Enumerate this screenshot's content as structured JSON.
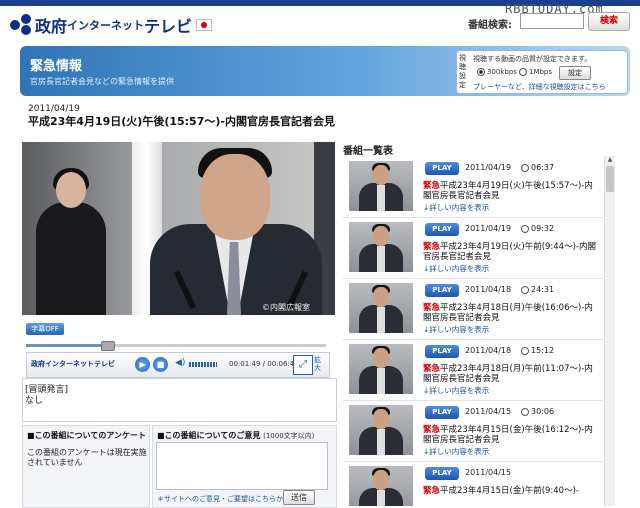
{
  "header": {
    "logo_text1": "政府",
    "logo_text2": "インターネット",
    "logo_text3": "テレビ",
    "search_label": "番組検索:",
    "search_button": "検索",
    "watermark": "RBBTODAY.com"
  },
  "banner": {
    "title": "緊急情報",
    "subtitle": "官房長官記者会見などの緊急情報を提供"
  },
  "quality": {
    "side_label": "視聴設定",
    "message": "視聴する動画の品質が設定できます。",
    "option1": "300kbps",
    "option2": "1Mbps",
    "selected": "300kbps",
    "set_button": "設定",
    "link": "プレーヤーなど、詳細な視聴設定はこちら"
  },
  "program": {
    "date": "2011/04/19",
    "title": "平成23年4月19日(火)午後(15:57〜)-内閣官房長官記者会見",
    "video_credit": "©内閣広報室"
  },
  "player": {
    "caption_button": "字幕OFF",
    "logo": "政府インターネットテレビ",
    "play_icon": "play-icon",
    "stop_icon": "stop-icon",
    "time": "00:01:49 / 00:06:46",
    "fullscreen_label": "拡大",
    "progress_fraction": 0.27
  },
  "transcript": {
    "heading": "[冒頭発言]",
    "body": "なし"
  },
  "survey": {
    "heading": "■この番組についてのアンケート",
    "text": "この番組のアンケートは現在実施されていません"
  },
  "opinion": {
    "heading": "■この番組についてのご意見",
    "limit": "(1000文字以内)",
    "link": "＊サイトへのご意見・ご要望はこちらから",
    "send_button": "送信"
  },
  "list": {
    "heading": "番組一覧表",
    "play_label": "PLAY",
    "more_label": "↓詳しい内容を表示",
    "emergency_tag": "緊急",
    "items": [
      {
        "date": "2011/04/19",
        "time": "06:37",
        "title": "平成23年4月19日(火)午後(15:57〜)-内閣官房長官記者会見"
      },
      {
        "date": "2011/04/19",
        "time": "09:32",
        "title": "平成23年4月19日(火)午前(9:44〜)-内閣官房長官記者会見"
      },
      {
        "date": "2011/04/18",
        "time": "24:31",
        "title": "平成23年4月18日(月)午後(16:06〜)-内閣官房長官記者会見"
      },
      {
        "date": "2011/04/18",
        "time": "15:12",
        "title": "平成23年4月18日(月)午前(11:07〜)-内閣官房長官記者会見"
      },
      {
        "date": "2011/04/15",
        "time": "30:06",
        "title": "平成23年4月15日(金)午後(16:12〜)-内閣官房長官記者会見"
      },
      {
        "date": "2011/04/15",
        "time": "",
        "title": "平成23年4月15日(金)午前(9:40〜)-"
      }
    ]
  }
}
